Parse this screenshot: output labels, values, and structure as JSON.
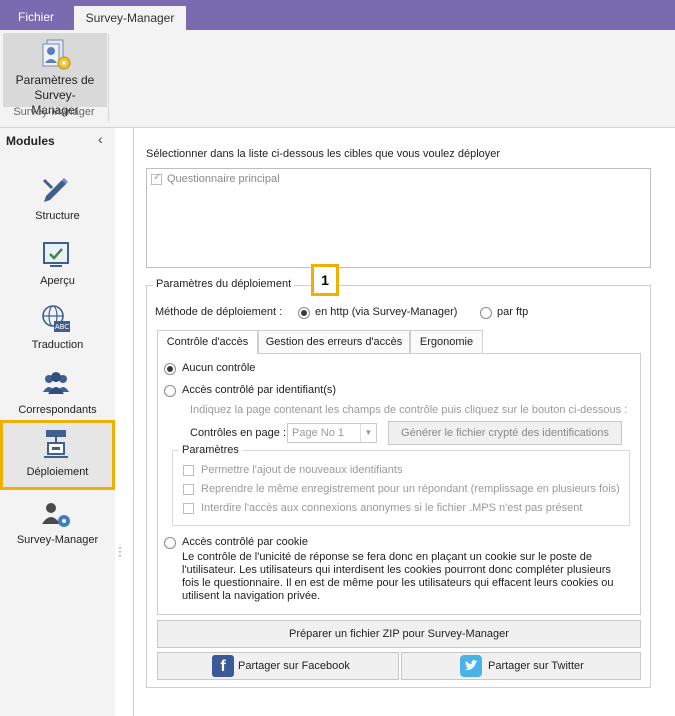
{
  "tabs": {
    "file": "Fichier",
    "survey_manager": "Survey-Manager"
  },
  "ribbon": {
    "button_label": "Paramètres de Survey-Manager",
    "group_label": "Survey-Manager"
  },
  "sidebar": {
    "header": "Modules",
    "items": [
      {
        "label": "Structure",
        "icon": "structure-icon"
      },
      {
        "label": "Aperçu",
        "icon": "preview-icon"
      },
      {
        "label": "Traduction",
        "icon": "translation-icon"
      },
      {
        "label": "Correspondants",
        "icon": "respondents-icon"
      },
      {
        "label": "Déploiement",
        "icon": "deployment-icon",
        "selected": true
      },
      {
        "label": "Survey-Manager",
        "icon": "survey-manager-icon"
      }
    ]
  },
  "main": {
    "instruction": "Sélectionner dans la liste ci-dessous les cibles que vous voulez déployer",
    "targets": [
      {
        "label": "Questionnaire principal",
        "checked": true
      }
    ],
    "deploy_params": {
      "legend": "Paramètres du déploiement",
      "badge": "1",
      "method_label": "Méthode de déploiement :",
      "method_http": "en http (via Survey-Manager)",
      "method_ftp": "par ftp",
      "tabs": [
        "Contrôle d'accès",
        "Gestion des erreurs d'accès",
        "Ergonomie"
      ],
      "access": {
        "none": "Aucun contrôle",
        "by_id": "Accès contrôlé par identifiant(s)",
        "by_id_hint": "Indiquez la page contenant les champs de contrôle puis cliquez sur le bouton ci-dessous :",
        "controls_page_label": "Contrôles en page :",
        "page_select_value": "Page No 1",
        "generate_button": "Générer le fichier crypté des identifications",
        "params_legend": "Paramètres",
        "params_options": [
          "Permettre l'ajout de nouveaux identifiants",
          "Reprendre le même enregistrement pour un répondant (remplissage en plusieurs fois)",
          "Interdire l'accès aux connexions anonymes si le fichier .MPS n'est pas présent"
        ],
        "cookie": "Accès contrôlé par cookie",
        "cookie_text": "Le contrôle de l'unicité de réponse se fera donc en plaçant un cookie sur le poste de l'utilisateur. Les utilisateurs qui interdisent les cookies pourront donc compléter plusieurs fois le questionnaire. Il en est de même pour les utilisateurs qui effacent leurs cookies ou utilisent la navigation privée."
      },
      "zip_button": "Préparer un fichier ZIP pour Survey-Manager",
      "facebook_button": "Partager sur Facebook",
      "twitter_button": "Partager sur Twitter"
    }
  },
  "colors": {
    "titlebar": "#7a6ab0",
    "highlight": "#f0b000",
    "facebook": "#3b5998",
    "twitter": "#4ab3e8"
  }
}
